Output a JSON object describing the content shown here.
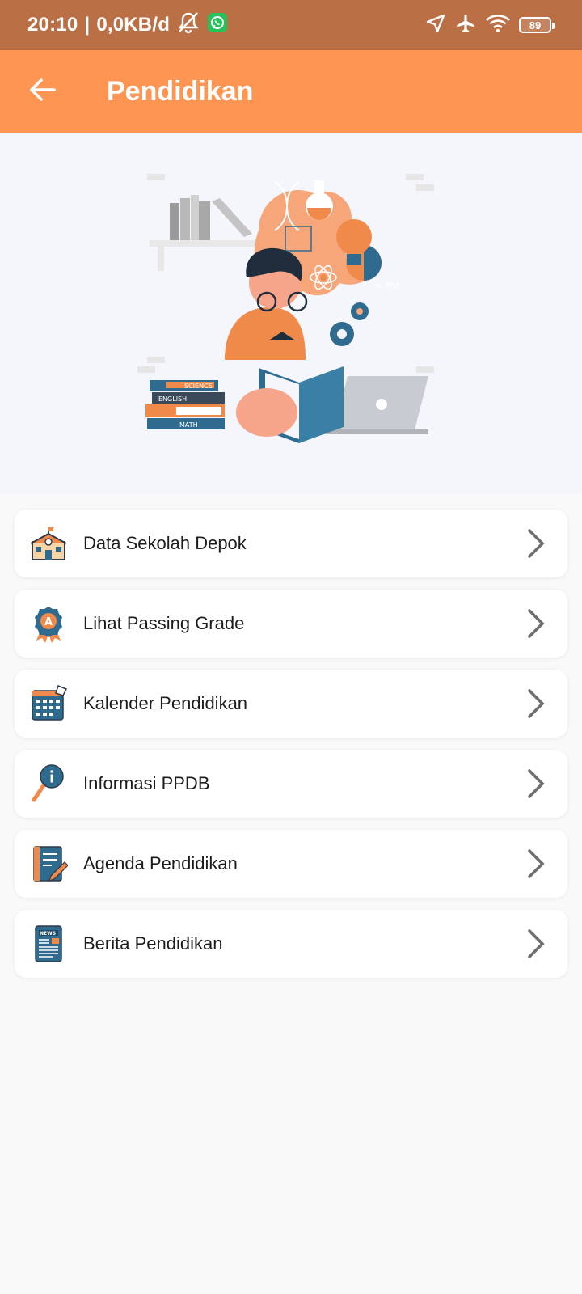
{
  "status_bar": {
    "time": "20:10",
    "separator": "|",
    "data_speed": "0,0KB/d",
    "battery_level": "89"
  },
  "app_bar": {
    "title": "Pendidikan",
    "back_icon": "arrow-left-icon"
  },
  "hero": {
    "book_labels": [
      "SCIENCE",
      "ENGLISH",
      "MATH"
    ],
    "formula": "= mc"
  },
  "menu": [
    {
      "label": "Data Sekolah Depok",
      "icon": "school-icon"
    },
    {
      "label": "Lihat Passing Grade",
      "icon": "grade-badge-icon"
    },
    {
      "label": "Kalender Pendidikan",
      "icon": "calendar-icon"
    },
    {
      "label": "Informasi PPDB",
      "icon": "info-search-icon"
    },
    {
      "label": "Agenda Pendidikan",
      "icon": "agenda-notebook-icon"
    },
    {
      "label": "Berita Pendidikan",
      "icon": "news-icon"
    }
  ],
  "colors": {
    "status_bar": "#bb6f45",
    "app_bar": "#ff9553",
    "accent_orange": "#f08a4b",
    "accent_blue": "#2f6b8e"
  }
}
